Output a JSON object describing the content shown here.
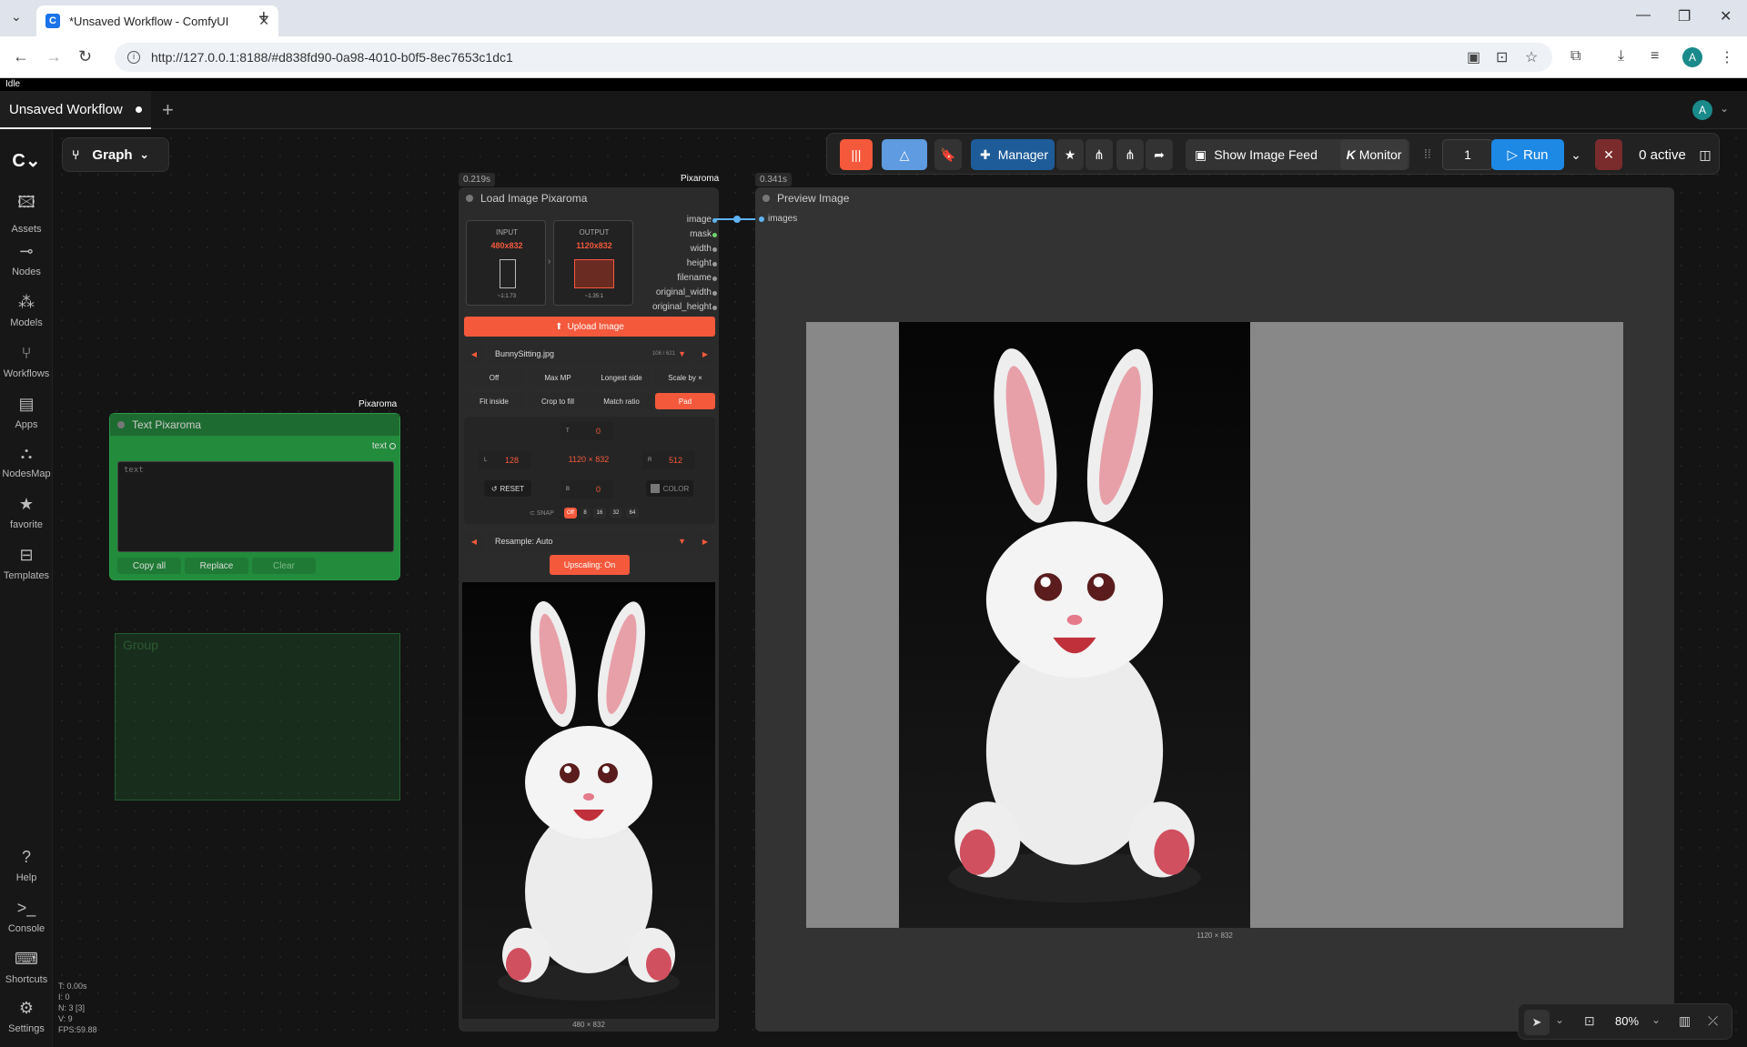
{
  "browser": {
    "tab_title": "*Unsaved Workflow - ComfyUI",
    "url": "http://127.0.0.1:8188/#d838fd90-0a98-4010-b0f5-8ec7653c1dc1",
    "profile_initial": "A"
  },
  "status": "Idle",
  "workflow_tab": "Unsaved Workflow",
  "graph_label": "Graph",
  "sidebar": {
    "items": [
      {
        "label": "Assets",
        "icon": "image-icon"
      },
      {
        "label": "Nodes",
        "icon": "nodes-icon"
      },
      {
        "label": "Models",
        "icon": "models-icon"
      },
      {
        "label": "Workflows",
        "icon": "workflows-icon"
      },
      {
        "label": "Apps",
        "icon": "apps-icon"
      },
      {
        "label": "NodesMap",
        "icon": "nodesmap-icon"
      },
      {
        "label": "favorite",
        "icon": "star-icon"
      },
      {
        "label": "Templates",
        "icon": "templates-icon"
      }
    ],
    "bottom": [
      {
        "label": "Help"
      },
      {
        "label": "Console"
      },
      {
        "label": "Shortcuts"
      },
      {
        "label": "Settings"
      }
    ]
  },
  "toolbar": {
    "manager": "Manager",
    "show_image_feed": "Show Image Feed",
    "monitor": "Monitor",
    "batch_count": "1",
    "run": "Run",
    "active": "0 active"
  },
  "text_node": {
    "badge": "Pixaroma",
    "title": "Text Pixaroma",
    "output": "text",
    "placeholder": "text",
    "btn_copy": "Copy all",
    "btn_replace": "Replace",
    "btn_clear": "Clear"
  },
  "group": {
    "title": "Group"
  },
  "load_node": {
    "time": "0.219s",
    "badge": "Pixaroma",
    "title": "Load Image Pixaroma",
    "input_label": "INPUT",
    "input_size": "480x832",
    "input_ratio": "~1:1.73",
    "output_label": "OUTPUT",
    "output_size": "1120x832",
    "output_ratio": "~1.35:1",
    "outputs": [
      "image",
      "mask",
      "width",
      "height",
      "filename",
      "original_width",
      "original_height"
    ],
    "upload": "Upload Image",
    "file": "BunnySitting.jpg",
    "file_index": "106 / 621",
    "mode_row1": [
      "Off",
      "Max MP",
      "Longest side",
      "Scale by ×"
    ],
    "mode_row2": [
      "Fit inside",
      "Crop to fill",
      "Match ratio",
      "Pad"
    ],
    "pad_t_label": "T",
    "pad_t": "0",
    "pad_l_label": "L",
    "pad_l": "128",
    "pad_r_label": "R",
    "pad_r": "512",
    "pad_b_label": "B",
    "pad_b": "0",
    "center_size": "1120 × 832",
    "reset": "RESET",
    "color": "COLOR",
    "snap_label": "SNAP",
    "snap_options": [
      "Off",
      "8",
      "16",
      "32",
      "64"
    ],
    "resample": "Resample: Auto",
    "upscaling": "Upscaling: On",
    "preview_caption": "480 × 832"
  },
  "preview_node": {
    "time": "0.341s",
    "title": "Preview Image",
    "input": "images",
    "caption": "1120 × 832"
  },
  "stats": {
    "t": "T: 0.00s",
    "i": "I: 0",
    "n": "N: 3 [3]",
    "v": "V: 9",
    "fps": "FPS:59.88"
  },
  "zoom": "80%",
  "colors": {
    "accent": "#f4593c",
    "run_blue": "#1e88e5",
    "group_green": "#2e7d32"
  }
}
